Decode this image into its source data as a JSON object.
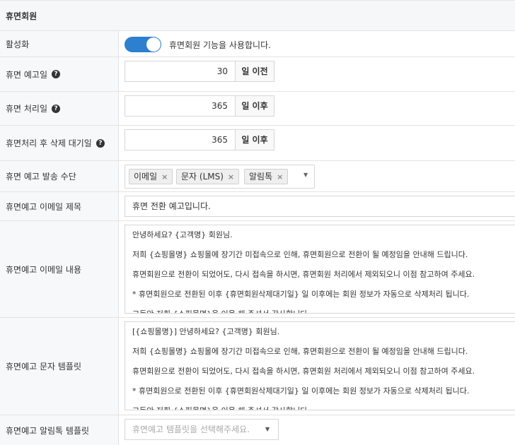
{
  "section_title": "휴면회원",
  "rows": {
    "activation": {
      "label": "활성화",
      "toggle_on": true,
      "description": "휴면회원 기능을 사용합니다."
    },
    "notice_day": {
      "label": "휴면 예고일",
      "value": "30",
      "unit": "일 이전"
    },
    "process_day": {
      "label": "휴면 처리일",
      "value": "365",
      "unit": "일 이후"
    },
    "delete_wait": {
      "label": "휴면처리 후 삭제 대기일",
      "value": "365",
      "unit": "일 이후"
    },
    "send_method": {
      "label": "휴면 예고 발송 수단",
      "tags": [
        "이메일",
        "문자 (LMS)",
        "알림톡"
      ],
      "remove_glyph": "×",
      "caret": "▼"
    },
    "email_subject": {
      "label": "휴면예고 이메일 제목",
      "value": "휴면 전환 예고입니다."
    },
    "email_body": {
      "label": "휴면예고 이메일 내용",
      "lines": [
        "안녕하세요? {고객명} 회원님.",
        "저희 {쇼핑몰명} 쇼핑몰에 장기간 미접속으로 인해, 휴면회원으로 전환이 될 예정임을 안내해 드립니다.",
        "휴면회원으로 전환이 되었어도, 다시 접속을 하시면, 휴면회원 처리에서 제외되오니 이점 참고하여 주세요.",
        "* 휴면회원으로 전환된 이후 {휴면회원삭제대기일} 일 이후에는 회원 정보가 자동으로 삭제처리 됩니다.",
        "그동안 저희 {쇼핑몰명}을 이용 해 주셔서 감사합니다."
      ]
    },
    "sms_template": {
      "label": "휴면예고 문자 템플릿",
      "lines": [
        "[{쇼핑몰명}] 안녕하세요? {고객명} 회원님.",
        "저희 {쇼핑몰명} 쇼핑몰에 장기간 미접속으로 인해, 휴면회원으로 전환이 될 예정임을 안내해 드립니다.",
        "휴면회원으로 전환이 되었어도, 다시 접속을 하시면, 휴면회원 처리에서 제외되오니 이점 참고하여 주세요.",
        "* 휴면회원으로 전환된 이후 {휴면회원삭제대기일} 일 이후에는 회원 정보가 자동으로 삭제처리 됩니다.",
        "그동안 저희 {쇼핑몰명}을 이용 해 주셔서 감사합니다."
      ]
    },
    "alimtalk_template": {
      "label": "휴면예고 알림톡 템플릿",
      "placeholder": "휴면예고 템플릿을 선택해주세요.",
      "caret": "▼"
    }
  },
  "help_glyph": "?",
  "colors": {
    "toggle_on": "#2d7fd0",
    "label_bg": "#f7f8fa",
    "border": "#e3e3e3"
  },
  "icons": {
    "help": "question-circle-icon",
    "remove": "close-icon",
    "dropdown": "chevron-down-icon"
  }
}
